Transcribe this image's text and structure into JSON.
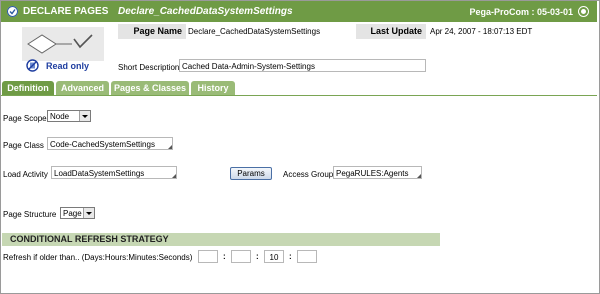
{
  "header": {
    "type_label": "DECLARE PAGES",
    "rule_name": "Declare_CachedDataSystemSettings",
    "version": "Pega-ProCom : 05-03-01",
    "colors": {
      "bar": "#6f9b45",
      "tab_inactive": "#9abb77",
      "section": "#c6d7b3"
    }
  },
  "info": {
    "page_name_label": "Page Name",
    "page_name_value": "Declare_CachedDataSystemSettings",
    "last_update_label": "Last Update",
    "last_update_value": "Apr 24, 2007 - 18:07:13 EDT",
    "read_only_label": "Read only",
    "short_description_label": "Short Description",
    "short_description_value": "Cached Data-Admin-System-Settings"
  },
  "tabs": [
    {
      "label": "Definition",
      "active": true
    },
    {
      "label": "Advanced",
      "active": false
    },
    {
      "label": "Pages & Classes",
      "active": false
    },
    {
      "label": "History",
      "active": false
    }
  ],
  "form": {
    "page_scope_label": "Page Scope",
    "page_scope_value": "Node",
    "page_class_label": "Page Class",
    "page_class_value": "Code-CachedSystemSettings",
    "load_activity_label": "Load Activity",
    "load_activity_value": "LoadDataSystemSettings",
    "params_label": "Params",
    "access_group_label": "Access Group",
    "access_group_value": "PegaRULES:Agents",
    "page_structure_label": "Page Structure",
    "page_structure_value": "Page"
  },
  "refresh": {
    "section_title": "CONDITIONAL REFRESH STRATEGY",
    "label": "Refresh if older than.. (Days:Hours:Minutes:Seconds)",
    "days": "",
    "hours": "",
    "minutes": "10",
    "seconds": "",
    "separator": ":"
  }
}
